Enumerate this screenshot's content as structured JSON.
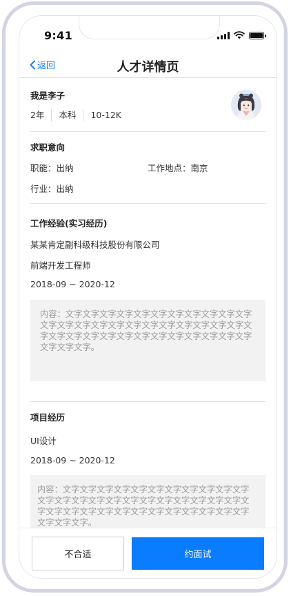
{
  "status_bar": {
    "time": "9:41"
  },
  "nav": {
    "back_label": "返回",
    "title": "人才详情页"
  },
  "profile": {
    "name": "我是李子",
    "tags": [
      "2年",
      "本科",
      "10-12K"
    ]
  },
  "intent": {
    "title": "求职意向",
    "function_label": "职能：出纳",
    "location_label": "工作地点：南京",
    "industry_label": "行业：出纳"
  },
  "work": {
    "title": "工作经验(实习经历)",
    "company": "某某肯定副科级科技股份有限公司",
    "position": "前端开发工程师",
    "period": "2018-09 ~ 2020-12",
    "description": "内容：文字文字文字文字文字文字文字文字文字文字文字文字文字文字文字文字文字文字文字文字文字文字文字文字文字文字文字文字文字文字文字文字文字文字文字文字文字文字文字。"
  },
  "project": {
    "title": "项目经历",
    "name": "UI设计",
    "period": "2018-09 ~ 2020-12",
    "description": "内容：文字文字文字文字文字文字文字文字文字文字文字文字文字文字文字文字文字文字文字文字文字文字文字文字文字文字文字文字文字文字文字文字文字文字文字文字文字文字文字。"
  },
  "actions": {
    "reject_label": "不合适",
    "interview_label": "约面试"
  },
  "colors": {
    "accent": "#0a7cff",
    "back_link": "#1a7cf0",
    "frame": "#d3d4e2",
    "desc_bg": "#f2f2f2"
  }
}
